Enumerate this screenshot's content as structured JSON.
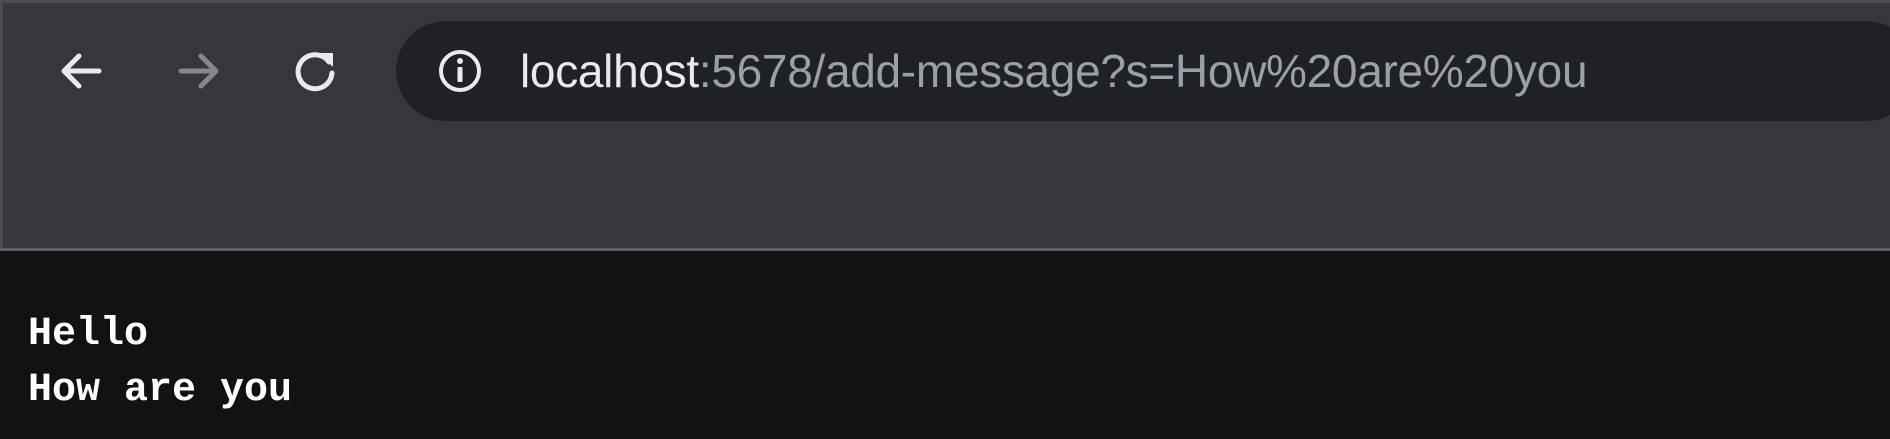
{
  "toolbar": {
    "back_icon": "arrow-left-icon",
    "forward_icon": "arrow-right-icon",
    "reload_icon": "reload-icon",
    "forward_disabled": true
  },
  "omnibox": {
    "site_info_icon": "info-icon",
    "url_host": "localhost",
    "url_rest": ":5678/add-message?s=How%20are%20you"
  },
  "page": {
    "messages": [
      "Hello",
      "How are you"
    ]
  },
  "colors": {
    "toolbar_bg": "#36373b",
    "omnibox_bg": "#202124",
    "page_bg": "#121212",
    "url_host": "#e8eaed",
    "url_rest": "#9aa0a6",
    "text": "#ffffff"
  }
}
